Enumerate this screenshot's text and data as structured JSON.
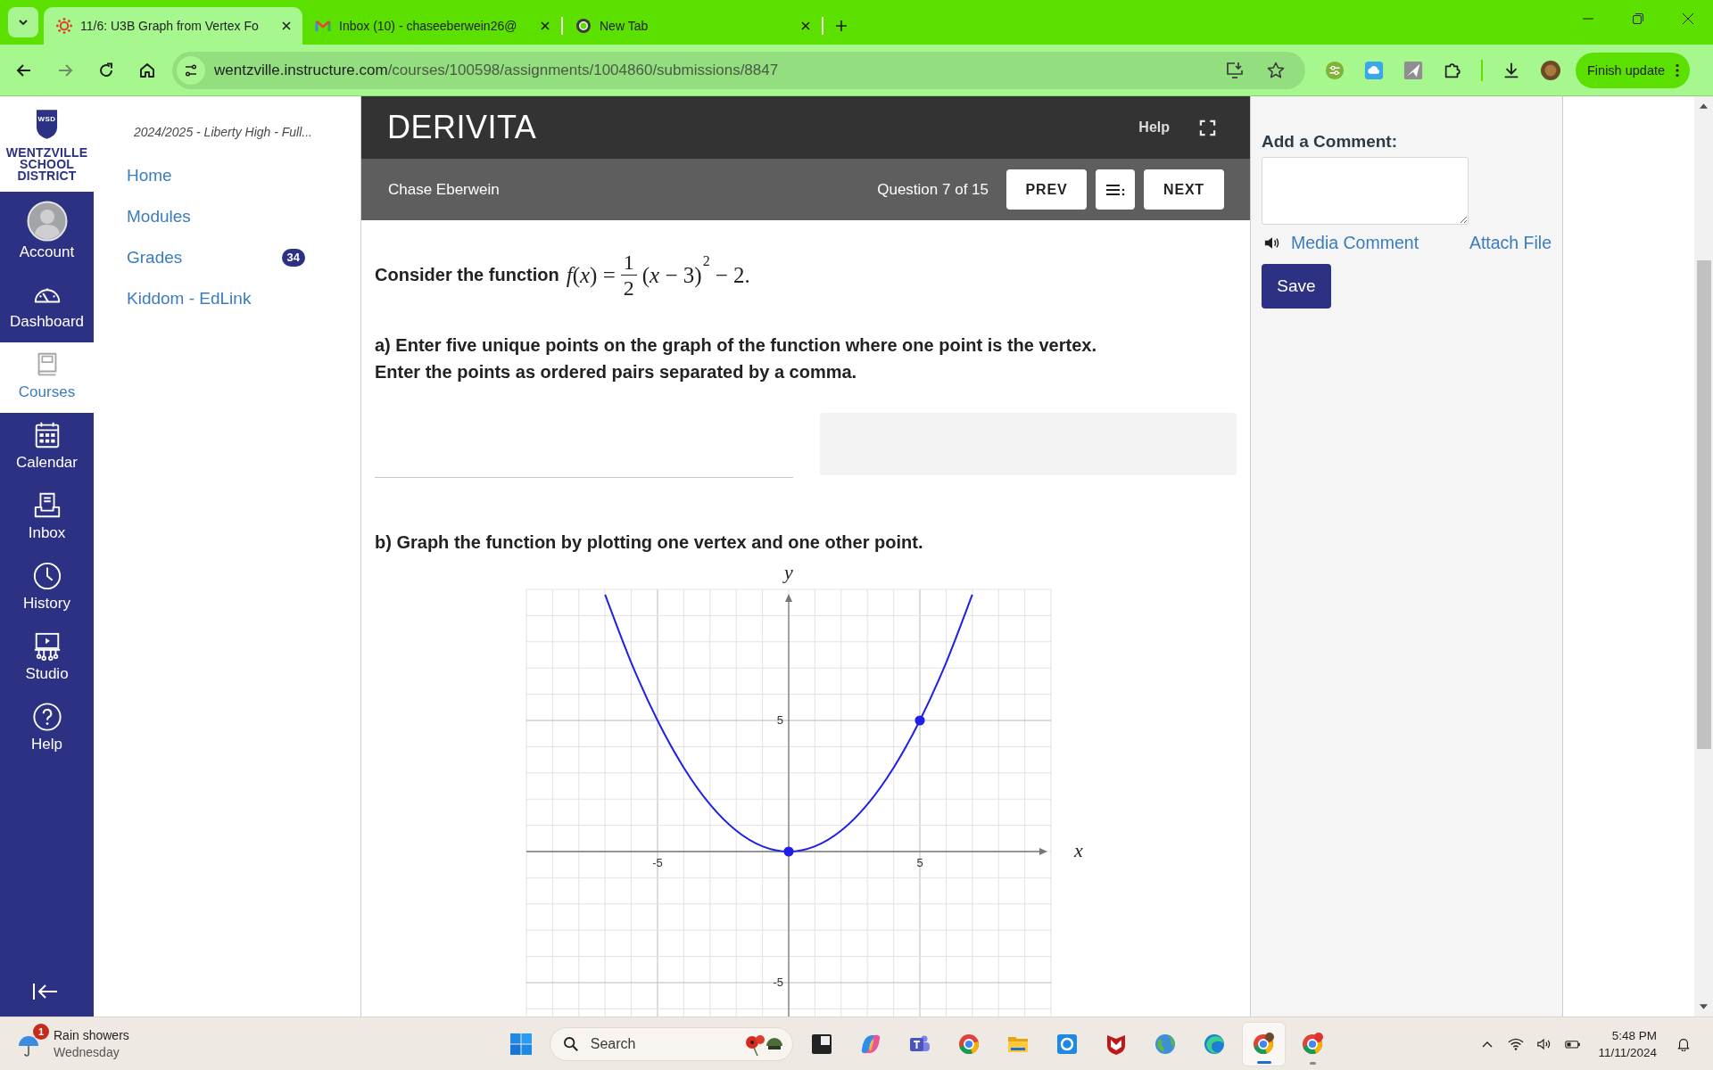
{
  "browser": {
    "tabs": [
      {
        "title": "11/6: U3B Graph from Vertex Fo",
        "selected": true
      },
      {
        "title": "Inbox (10) - chaseeberwein26@",
        "selected": false
      },
      {
        "title": "New Tab",
        "selected": false
      }
    ],
    "url_host": "wentzville.instructure.com",
    "url_path": "/courses/100598/assignments/1004860/submissions/8847",
    "update_button": "Finish update"
  },
  "district_logo": {
    "mark": "WSD",
    "lines": [
      "WENTZVILLE",
      "SCHOOL",
      "DISTRICT"
    ]
  },
  "global_nav": [
    {
      "label": "Account",
      "selected": false
    },
    {
      "label": "Dashboard",
      "selected": false
    },
    {
      "label": "Courses",
      "selected": true
    },
    {
      "label": "Calendar",
      "selected": false
    },
    {
      "label": "Inbox",
      "selected": false
    },
    {
      "label": "History",
      "selected": false
    },
    {
      "label": "Studio",
      "selected": false
    },
    {
      "label": "Help",
      "selected": false
    }
  ],
  "course_nav": {
    "breadcrumb": "2024/2025 - Liberty High - Full...",
    "items": [
      {
        "label": "Home"
      },
      {
        "label": "Modules"
      },
      {
        "label": "Grades",
        "badge": "34"
      },
      {
        "label": "Kiddom - EdLink"
      }
    ]
  },
  "derivita": {
    "logo": "DERIVITA",
    "help": "Help",
    "student": "Chase Eberwein",
    "progress": "Question 7 of 15",
    "prev": "PREV",
    "next": "NEXT",
    "question": {
      "intro": "Consider the function",
      "lhs": "*f*(*x*) =",
      "numerator": "1",
      "denominator": "2",
      "base": "(*x* − 3)",
      "exponent": "2",
      "tail": "− 2."
    },
    "part_a": [
      "a) Enter five unique points on the graph of the function where one point is the vertex.",
      "Enter the points as ordered pairs separated by a comma."
    ],
    "part_b": "b) Graph the function by plotting one vertex and one other point.",
    "graph": {
      "chart_data": {
        "type": "line",
        "xlabel": "x",
        "ylabel": "y",
        "xlim": [
          -10,
          10
        ],
        "ylim": [
          -6.3,
          10
        ],
        "xticks": [
          -5,
          5
        ],
        "yticks": [
          -5,
          5
        ],
        "grid": true,
        "x": [
          -7,
          -6,
          -5,
          -4,
          -3,
          -2,
          -1,
          0,
          1,
          2,
          3,
          4,
          5,
          6,
          7
        ],
        "series": [
          {
            "color": "#1f1fe6",
            "values": [
              9.8,
              7.2,
              5,
              3.2,
              1.8,
              0.8,
              0.2,
              0,
              0.2,
              0.8,
              1.8,
              3.2,
              5,
              7.2,
              9.8
            ]
          },
          {
            "color": "#1f1fe6",
            "values": [
              null,
              null,
              null,
              null,
              null,
              null,
              null,
              0,
              null,
              null,
              null,
              null,
              5,
              null,
              null
            ]
          }
        ]
      }
    }
  },
  "comments": {
    "heading": "Add a Comment:",
    "media_comment": "Media Comment",
    "attach_file": "Attach File",
    "save": "Save"
  },
  "taskbar": {
    "weather": {
      "badge": "1",
      "condition": "Rain showers",
      "day": "Wednesday"
    },
    "search_placeholder": "Search",
    "apps": [
      {
        "selected": false,
        "running": false
      },
      {
        "selected": false,
        "running": false
      },
      {
        "selected": false,
        "running": false
      },
      {
        "selected": false,
        "running": false
      },
      {
        "selected": false,
        "running": false
      },
      {
        "selected": false,
        "running": false
      },
      {
        "selected": false,
        "running": false
      },
      {
        "selected": false,
        "running": false
      },
      {
        "selected": false,
        "running": false
      },
      {
        "selected": true,
        "running": true
      },
      {
        "selected": false,
        "running": true
      }
    ],
    "time": "5:48 PM",
    "date": "11/11/2024"
  }
}
